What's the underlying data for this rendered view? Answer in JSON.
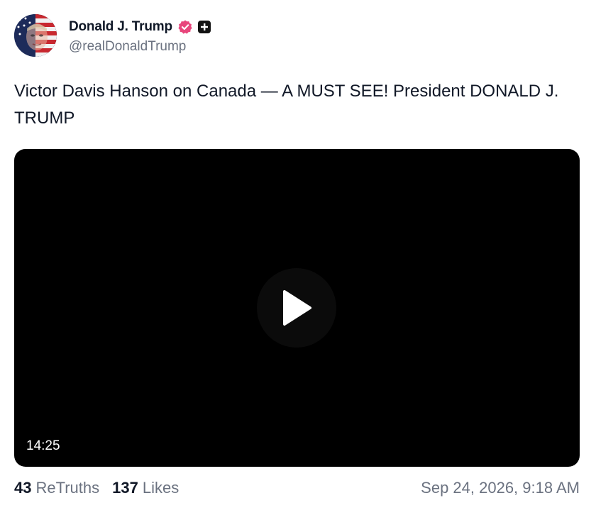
{
  "author": {
    "display_name": "Donald J. Trump",
    "handle": "@realDonaldTrump",
    "verified_icon": "verified-badge-icon",
    "plus_icon": "plus-badge-icon",
    "verified_color": "#e8467c"
  },
  "post": {
    "text": "Victor Davis Hanson on Canada — A MUST SEE! President DONALD J. TRUMP"
  },
  "video": {
    "duration": "14:25",
    "play_icon": "play-icon"
  },
  "stats": {
    "retruths_count": "43",
    "retruths_label": "ReTruths",
    "likes_count": "137",
    "likes_label": "Likes"
  },
  "timestamp": "Sep 24, 2026, 9:18 AM"
}
